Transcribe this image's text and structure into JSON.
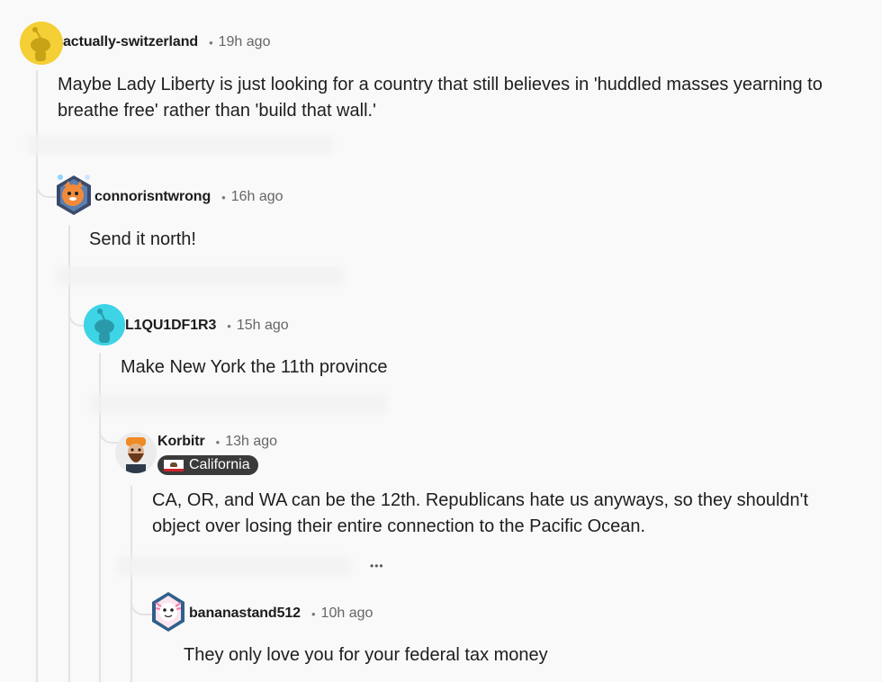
{
  "comments": [
    {
      "username": "actually-switzerland",
      "separator": "•",
      "time": "19h ago",
      "avatar": "snoo-avatar-yellow",
      "body": "Maybe Lady Liberty is just looking for a country that still believes in 'huddled masses yearning to breathe free' rather than 'build that wall.'"
    },
    {
      "username": "connorisntwrong",
      "separator": "•",
      "time": "16h ago",
      "avatar": "orange-cat-avatar",
      "body": "Send it north!"
    },
    {
      "username": "L1QU1DF1R3",
      "separator": "•",
      "time": "15h ago",
      "avatar": "snoo-avatar-cyan",
      "body": "Make New York the 11th province"
    },
    {
      "username": "Korbitr",
      "separator": "•",
      "time": "13h ago",
      "avatar": "bearded-man-avatar",
      "flair": "California",
      "flair_icon": "california-flag-icon",
      "body": "CA, OR, and WA can be the 12th. Republicans hate us anyways, so they shouldn't object over losing their entire connection to the Pacific Ocean."
    },
    {
      "username": "bananastand512",
      "separator": "•",
      "time": "10h ago",
      "avatar": "axolotl-avatar",
      "body": "They only love you for your federal tax money"
    }
  ],
  "more_label": "•••",
  "colors": {
    "background": "#f9f9f9",
    "thread_line": "#e3e3e3",
    "username": "#1c1c1c",
    "meta": "#666666",
    "flair_bg": "#3a3a3a",
    "snoo_yellow": "#f4cf36",
    "snoo_cyan": "#3dd4e6"
  }
}
